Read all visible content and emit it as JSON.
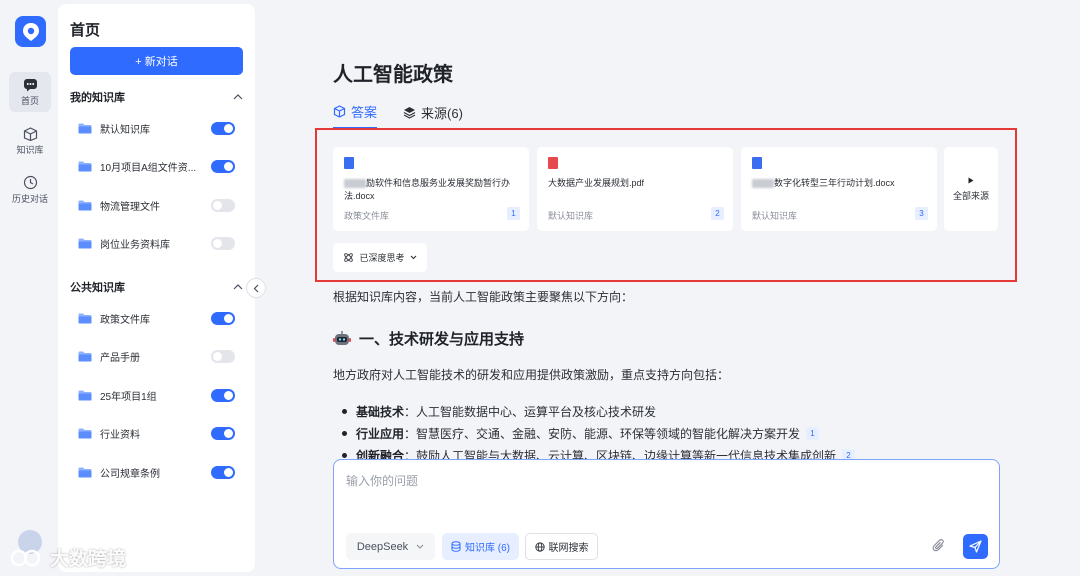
{
  "rail": {
    "items": [
      {
        "label": "首页",
        "icon": "chat-icon"
      },
      {
        "label": "知识库",
        "icon": "box-icon"
      },
      {
        "label": "历史对话",
        "icon": "clock-icon"
      }
    ]
  },
  "sidebar": {
    "title": "首页",
    "new_chat": "+ 新对话",
    "my_kb_title": "我的知识库",
    "my_kb": [
      {
        "name": "默认知识库",
        "enabled": true
      },
      {
        "name": "10月项目A组文件资...",
        "enabled": true
      },
      {
        "name": "物流管理文件",
        "enabled": false
      },
      {
        "name": "岗位业务资料库",
        "enabled": false
      }
    ],
    "public_kb_title": "公共知识库",
    "public_kb": [
      {
        "name": "政策文件库",
        "enabled": true
      },
      {
        "name": "产品手册",
        "enabled": false
      },
      {
        "name": "25年项目1组",
        "enabled": true
      },
      {
        "name": "行业资料",
        "enabled": true
      },
      {
        "name": "公司规章条例",
        "enabled": true
      }
    ]
  },
  "main": {
    "title": "人工智能政策",
    "tabs": [
      {
        "label": "答案"
      },
      {
        "label": "来源(6)"
      }
    ],
    "sources": [
      {
        "name": "励软件和信息服务业发展奖励暂行办法.docx",
        "library": "政策文件库",
        "num": "1",
        "type": "docx",
        "color": "#3b6df0"
      },
      {
        "name": "大数据产业发展规划.pdf",
        "library": "默认知识库",
        "num": "2",
        "type": "pdf",
        "color": "#e5484d"
      },
      {
        "name": "数字化转型三年行动计划.docx",
        "library": "默认知识库",
        "num": "3",
        "type": "docx",
        "color": "#3b6df0"
      }
    ],
    "all_sources": "全部来源",
    "deep_think": "已深度思考",
    "intro": "根据知识库内容，当前人工智能政策主要聚焦以下方向：",
    "section_title": "一、技术研发与应用支持",
    "section_para": "地方政府对人工智能技术的研发和应用提供政策激励，重点支持方向包括：",
    "bullets": [
      {
        "bold": "基础技术",
        "text": "：人工智能数据中心、运算平台及核心技术研发",
        "ref": ""
      },
      {
        "bold": "行业应用",
        "text": "：智慧医疗、交通、金融、安防、能源、环保等领域的智能化解决方案开发",
        "ref": "1"
      },
      {
        "bold": "创新融合",
        "text": "：鼓励人工智能与大数据、云计算、区块链、边缘计算等新一代信息技术集成创新",
        "ref": "2"
      }
    ]
  },
  "input": {
    "placeholder": "输入你的问题",
    "model": "DeepSeek",
    "kb_chip": "知识库 (6)",
    "web_chip": "联网搜索"
  },
  "watermark": "大数跨境",
  "colors": {
    "accent": "#2f6bff",
    "highlight_frame": "#e53935"
  }
}
